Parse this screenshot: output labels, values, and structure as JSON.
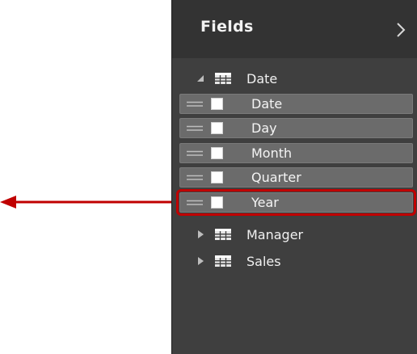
{
  "panel": {
    "title": "Fields",
    "collapse_icon": "chevron-right-icon"
  },
  "tables": [
    {
      "name": "Date",
      "expanded": true,
      "fields": [
        {
          "name": "Date",
          "checked": false
        },
        {
          "name": "Day",
          "checked": false
        },
        {
          "name": "Month",
          "checked": false
        },
        {
          "name": "Quarter",
          "checked": false
        },
        {
          "name": "Year",
          "checked": false,
          "highlighted": true
        }
      ]
    },
    {
      "name": "Manager",
      "expanded": false
    },
    {
      "name": "Sales",
      "expanded": false
    }
  ],
  "annotation": {
    "arrow_color": "#c00000",
    "highlight_color": "#c00000"
  }
}
